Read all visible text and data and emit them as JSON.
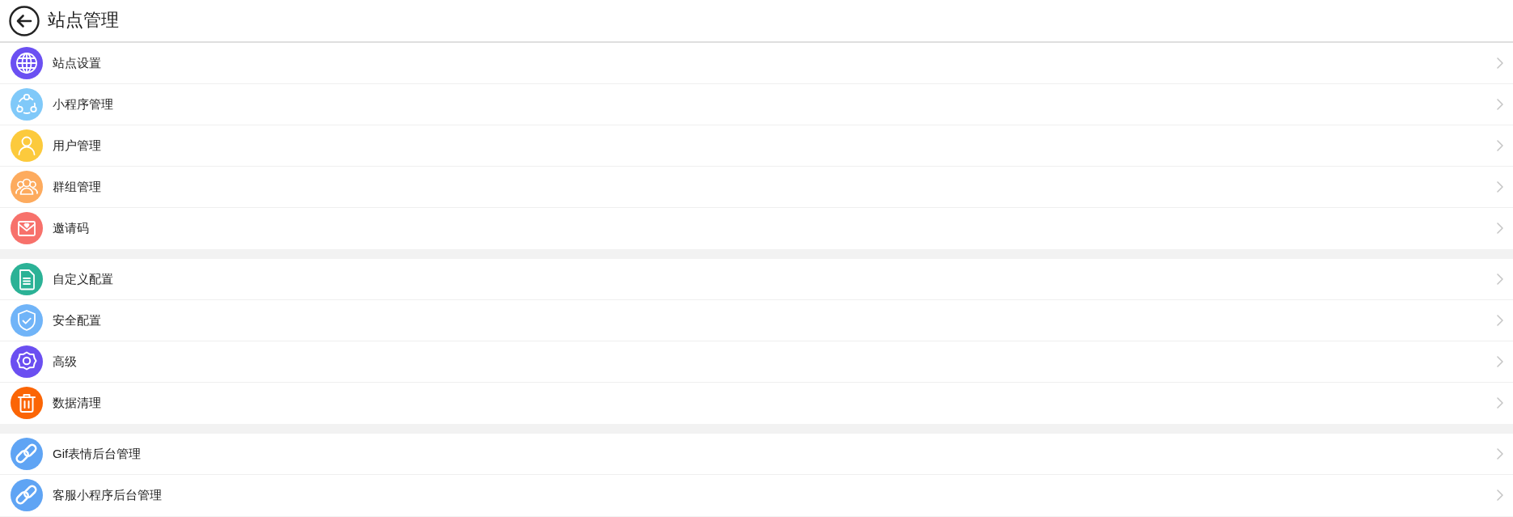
{
  "header": {
    "title": "站点管理"
  },
  "groups": [
    {
      "items": [
        {
          "kind": "globe",
          "color": "#6b50f2",
          "label": "站点设置"
        },
        {
          "kind": "network",
          "color": "#80c9f9",
          "label": "小程序管理"
        },
        {
          "kind": "person",
          "color": "#fcca3c",
          "label": "用户管理"
        },
        {
          "kind": "people",
          "color": "#fdab5e",
          "label": "群组管理"
        },
        {
          "kind": "envelope",
          "color": "#f7716b",
          "label": "邀请码"
        }
      ]
    },
    {
      "items": [
        {
          "kind": "document",
          "color": "#2bb296",
          "label": "自定义配置"
        },
        {
          "kind": "shield",
          "color": "#70b4f8",
          "label": "安全配置"
        },
        {
          "kind": "gear",
          "color": "#6b4ff1",
          "label": "高级"
        },
        {
          "kind": "trash",
          "color": "#fb6505",
          "label": "数据清理"
        }
      ]
    },
    {
      "items": [
        {
          "kind": "link",
          "color": "#5fa4f4",
          "label": "Gif表情后台管理"
        },
        {
          "kind": "link",
          "color": "#5fa4f4",
          "label": "客服小程序后台管理"
        }
      ]
    }
  ]
}
